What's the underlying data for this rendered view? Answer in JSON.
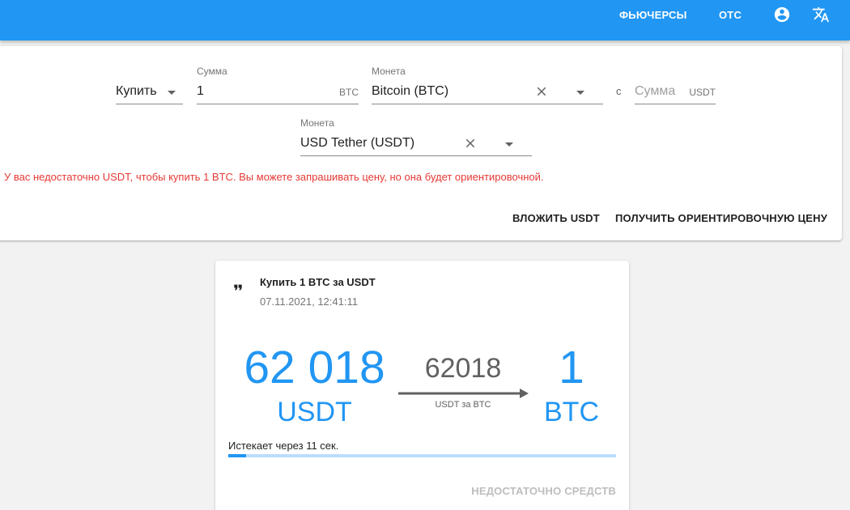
{
  "header": {
    "futures_label": "ФЬЮЧЕРСЫ",
    "otc_label": "OTC",
    "account_icon": "account-circle-icon",
    "translate_icon": "translate-icon"
  },
  "form": {
    "side": {
      "value": "Купить"
    },
    "amount": {
      "label": "Сумма",
      "value": "1",
      "suffix": "BTC"
    },
    "coin": {
      "label": "Монета",
      "value": "Bitcoin (BTC)"
    },
    "with_label": "с",
    "quote_amount": {
      "placeholder": "Сумма",
      "suffix": "USDT"
    },
    "quote_coin": {
      "label": "Монета",
      "value": "USD Tether (USDT)"
    },
    "warning": "У вас недостаточно USDT, чтобы купить 1 BTC. Вы можете запрашивать цену, но она будет ориентировочной.",
    "deposit_label": "ВЛОЖИТЬ USDT",
    "get_price_label": "ПОЛУЧИТЬ ОРИЕНТИРОВОЧНУЮ ЦЕНУ"
  },
  "quote": {
    "icon": "format-quote-icon",
    "title": "Купить 1 BTC за USDT",
    "date": "07.11.2021, 12:41:11",
    "pay_amount": "62 018",
    "pay_unit": "USDT",
    "rate": "62018",
    "rate_unit": "USDT за BTC",
    "receive_amount": "1",
    "receive_unit": "BTC",
    "expires": "Истекает через 11 сек.",
    "progress_fraction": 0.045,
    "insufficient_label": "НЕДОСТАТОЧНО СРЕДСТВ"
  },
  "colors": {
    "primary": "#2196f3",
    "error": "#e53935",
    "progress_track": "#bbdefb"
  }
}
